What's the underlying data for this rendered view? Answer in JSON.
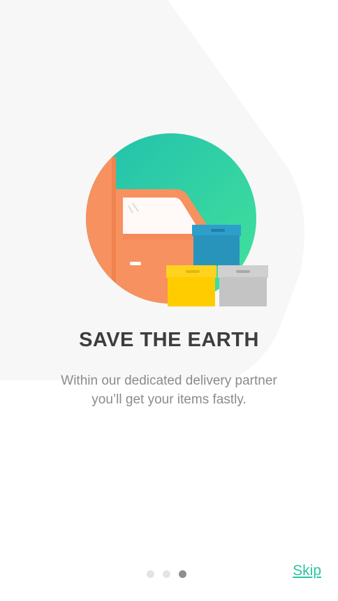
{
  "onboarding": {
    "title": "SAVE THE EARTH",
    "description_line1": "Within our dedicated delivery partner",
    "description_line2": "you’ll get your items fastly.",
    "skip_label": "Skip",
    "pager": {
      "total": 3,
      "active_index": 2
    }
  },
  "illustration": {
    "icon": "delivery-truck-with-boxes-icon",
    "colors": {
      "circle_gradient_start": "#21bfae",
      "circle_gradient_end": "#43e39a",
      "truck": "#f7915f",
      "box_blue": "#2894bc",
      "box_yellow": "#ffcc00",
      "box_gray": "#c4c4c4"
    }
  },
  "colors": {
    "title": "#3d3d3d",
    "description": "#8b8b8b",
    "skip": "#2cc4a3",
    "dot_active": "#8e8e8e",
    "dot_inactive": "#e4e4e4"
  }
}
